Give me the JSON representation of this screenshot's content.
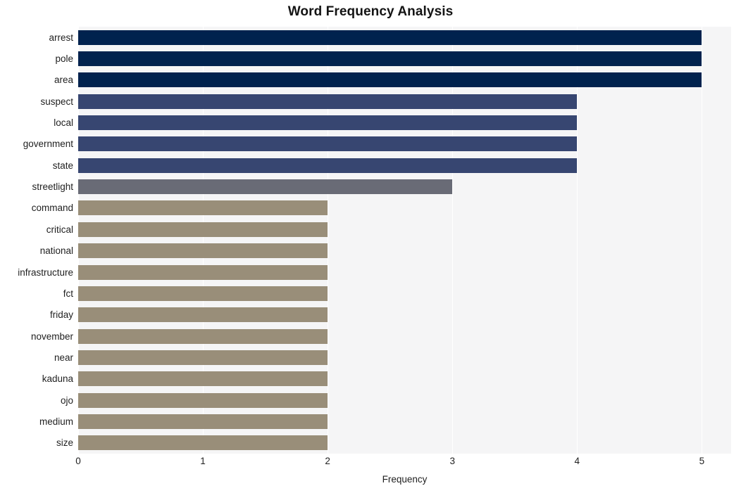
{
  "chart_data": {
    "type": "bar",
    "orientation": "horizontal",
    "title": "Word Frequency Analysis",
    "xlabel": "Frequency",
    "ylabel": "",
    "categories": [
      "arrest",
      "pole",
      "area",
      "suspect",
      "local",
      "government",
      "state",
      "streetlight",
      "command",
      "critical",
      "national",
      "infrastructure",
      "fct",
      "friday",
      "november",
      "near",
      "kaduna",
      "ojo",
      "medium",
      "size"
    ],
    "values": [
      5,
      5,
      5,
      4,
      4,
      4,
      4,
      3,
      2,
      2,
      2,
      2,
      2,
      2,
      2,
      2,
      2,
      2,
      2,
      2
    ],
    "bar_colors": [
      "#00224e",
      "#00224e",
      "#00224e",
      "#374671",
      "#374671",
      "#374671",
      "#374671",
      "#696b76",
      "#998e79",
      "#998e79",
      "#998e79",
      "#998e79",
      "#998e79",
      "#998e79",
      "#998e79",
      "#998e79",
      "#998e79",
      "#998e79",
      "#998e79",
      "#998e79"
    ],
    "xlim": [
      0,
      5.235
    ],
    "xticks": [
      0,
      1,
      2,
      3,
      4,
      5
    ],
    "xtick_labels": [
      "0",
      "1",
      "2",
      "3",
      "4",
      "5"
    ],
    "grid": true,
    "grid_color": "#ffffff",
    "plot_background": "#f5f5f6",
    "figure_background": "#ffffff",
    "legend": "none"
  }
}
